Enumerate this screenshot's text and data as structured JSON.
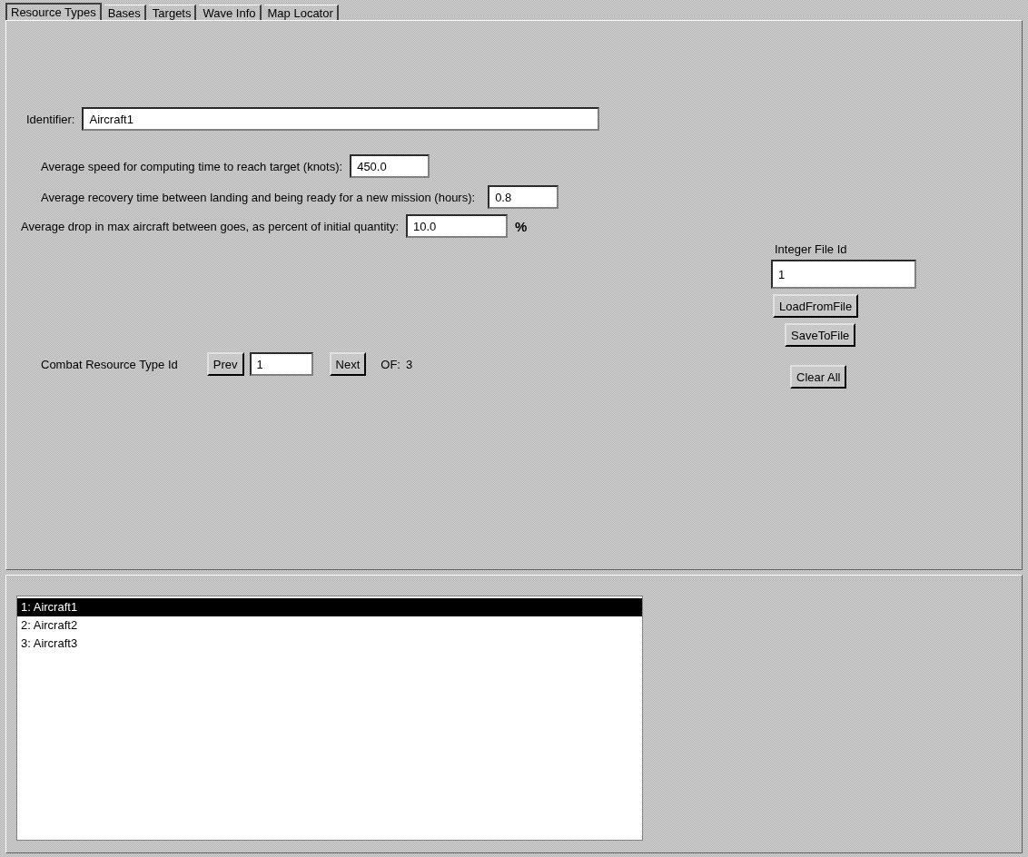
{
  "tabs": [
    {
      "label": "Resource Types",
      "selected": true
    },
    {
      "label": "Bases",
      "selected": false
    },
    {
      "label": "Targets",
      "selected": false
    },
    {
      "label": "Wave Info",
      "selected": false
    },
    {
      "label": "Map Locator",
      "selected": false
    }
  ],
  "identifier": {
    "label": "Identifier:",
    "value": "Aircraft1"
  },
  "fields": [
    {
      "label": "Average speed for computing time to reach target (knots):",
      "value": "450.0"
    },
    {
      "label": "Average recovery time between landing and being ready for a new mission (hours):",
      "value": "0.8"
    },
    {
      "label": "Average drop in max aircraft between goes, as percent of initial quantity:",
      "value": "10.0",
      "unit": "%"
    }
  ],
  "navigator": {
    "label": "Combat Resource Type Id",
    "prev": "Prev",
    "value": "1",
    "next": "Next",
    "of_label": "OF:",
    "total": "3"
  },
  "file_panel": {
    "label": "Integer File Id",
    "value": "1",
    "buttons": [
      "LoadFromFile",
      "SaveToFile",
      "Clear All"
    ]
  },
  "list": [
    {
      "text": "1: Aircraft1",
      "selected": true
    },
    {
      "text": "2: Aircraft2",
      "selected": false
    },
    {
      "text": "3: Aircraft3",
      "selected": false
    }
  ]
}
